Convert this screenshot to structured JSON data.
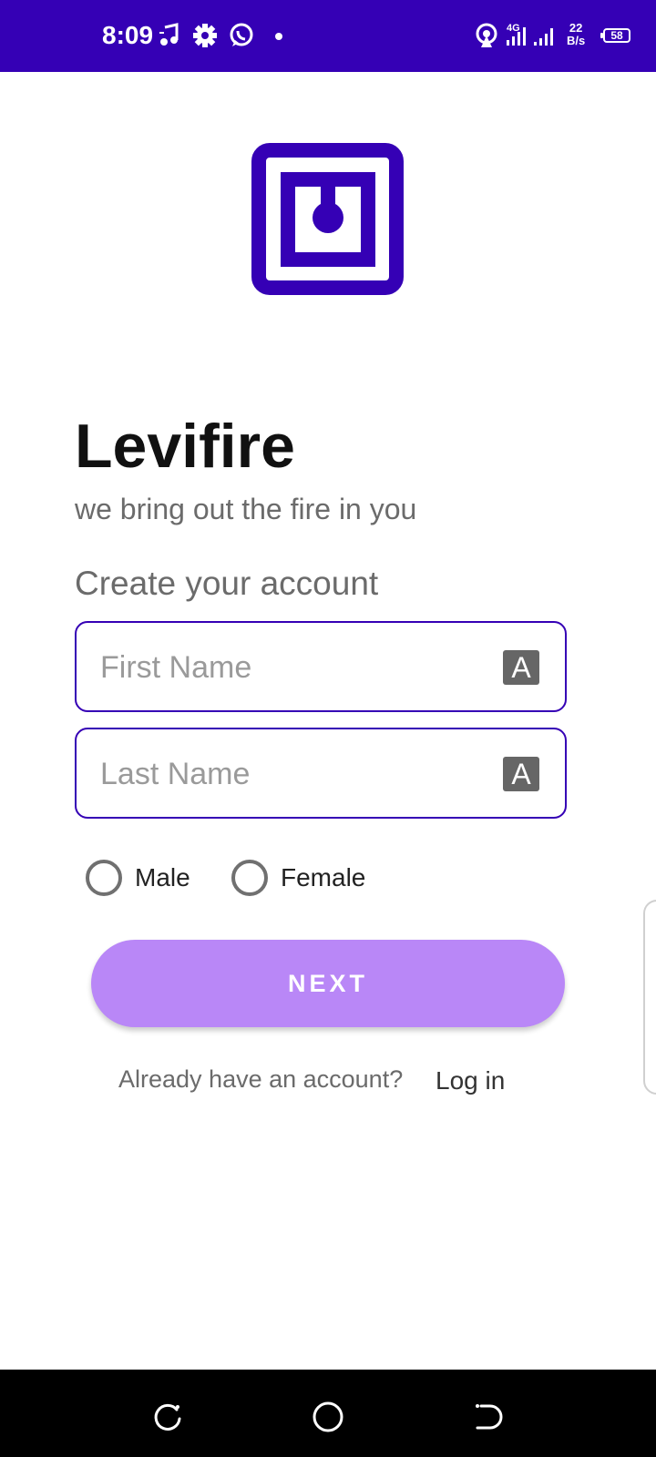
{
  "status_bar": {
    "time": "8:09",
    "network_speed_value": "22",
    "network_speed_unit": "B/s",
    "network_type": "4G",
    "battery": "58",
    "icons": [
      "music-icon",
      "settings-icon",
      "whatsapp-icon",
      "hotspot-icon",
      "signal-icon",
      "battery-icon"
    ],
    "background_color": "#3500b5"
  },
  "app": {
    "title": "Levifire",
    "tagline": "we bring out the fire in you",
    "brand_color": "#3500b5"
  },
  "form": {
    "heading": "Create your account",
    "first_name": {
      "placeholder": "First Name",
      "value": ""
    },
    "last_name": {
      "placeholder": "Last Name",
      "value": ""
    },
    "autofill_icon_glyph": "A",
    "gender_options": [
      {
        "label": "Male",
        "selected": false
      },
      {
        "label": "Female",
        "selected": false
      }
    ],
    "next_label": "NEXT",
    "next_button_color": "#b987f7"
  },
  "footer": {
    "prompt": "Already have an account?",
    "login_label": "Log in"
  },
  "nav_bar": {
    "buttons": [
      "recent-apps-icon",
      "home-icon",
      "back-icon"
    ]
  }
}
